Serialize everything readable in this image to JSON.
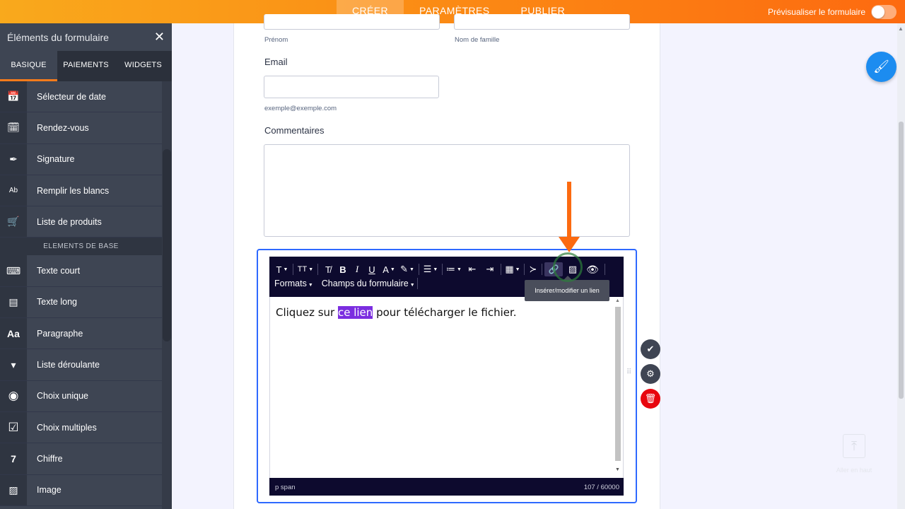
{
  "topbar": {
    "tabs": [
      {
        "label": "CRÉER"
      },
      {
        "label": "PARAMÈTRES"
      },
      {
        "label": "PUBLIER"
      }
    ],
    "preview_label": "Prévisualiser le formulaire"
  },
  "sidebar": {
    "title": "Éléments du formulaire",
    "close_glyph": "✕",
    "tabs": [
      {
        "label": "BASIQUE"
      },
      {
        "label": "PAIEMENTS"
      },
      {
        "label": "WIDGETS"
      }
    ],
    "items_top": [
      {
        "label": "Sélecteur de date",
        "icon": "calendar-icon",
        "glyph": "📅"
      },
      {
        "label": "Rendez-vous",
        "icon": "calendar-check-icon",
        "glyph": "🗓"
      },
      {
        "label": "Signature",
        "icon": "pen-icon",
        "glyph": "✒"
      },
      {
        "label": "Remplir les blancs",
        "icon": "fill-blanks-icon",
        "glyph": "Ab"
      },
      {
        "label": "Liste de produits",
        "icon": "cart-icon",
        "glyph": "🛒"
      }
    ],
    "section_label": "ELEMENTS DE BASE",
    "items_basic": [
      {
        "label": "Texte court",
        "icon": "short-text-icon",
        "glyph": "⌨"
      },
      {
        "label": "Texte long",
        "icon": "long-text-icon",
        "glyph": "▤"
      },
      {
        "label": "Paragraphe",
        "icon": "paragraph-icon",
        "glyph": "Aa"
      },
      {
        "label": "Liste déroulante",
        "icon": "dropdown-icon",
        "glyph": "▾"
      },
      {
        "label": "Choix unique",
        "icon": "radio-icon",
        "glyph": "◉"
      },
      {
        "label": "Choix multiples",
        "icon": "checkbox-icon",
        "glyph": "☑"
      },
      {
        "label": "Chiffre",
        "icon": "number-icon",
        "glyph": "7"
      },
      {
        "label": "Image",
        "icon": "image-icon",
        "glyph": "▨"
      }
    ]
  },
  "form": {
    "first_name_sublabel": "Prénom",
    "last_name_sublabel": "Nom de famille",
    "email_label": "Email",
    "email_sublabel": "exemple@exemple.com",
    "comments_label": "Commentaires"
  },
  "editor": {
    "toolbar_row2": {
      "formats_label": "Formats",
      "fields_label": "Champs du formulaire"
    },
    "text_before": "Cliquez sur ",
    "text_highlight": "ce lien",
    "text_after": " pour télécharger le fichier.",
    "status_path": "p  span",
    "status_count": "107 / 60000",
    "tooltip": "Insérer/modifier un lien"
  },
  "back_to_top_label": "Aller en haut",
  "colors": {
    "accent": "#fd6a10",
    "sidebar": "#3e4553",
    "editor_toolbar": "#0d0a2e",
    "highlight": "#7b2ee0",
    "selection_border": "#2e69ff"
  }
}
